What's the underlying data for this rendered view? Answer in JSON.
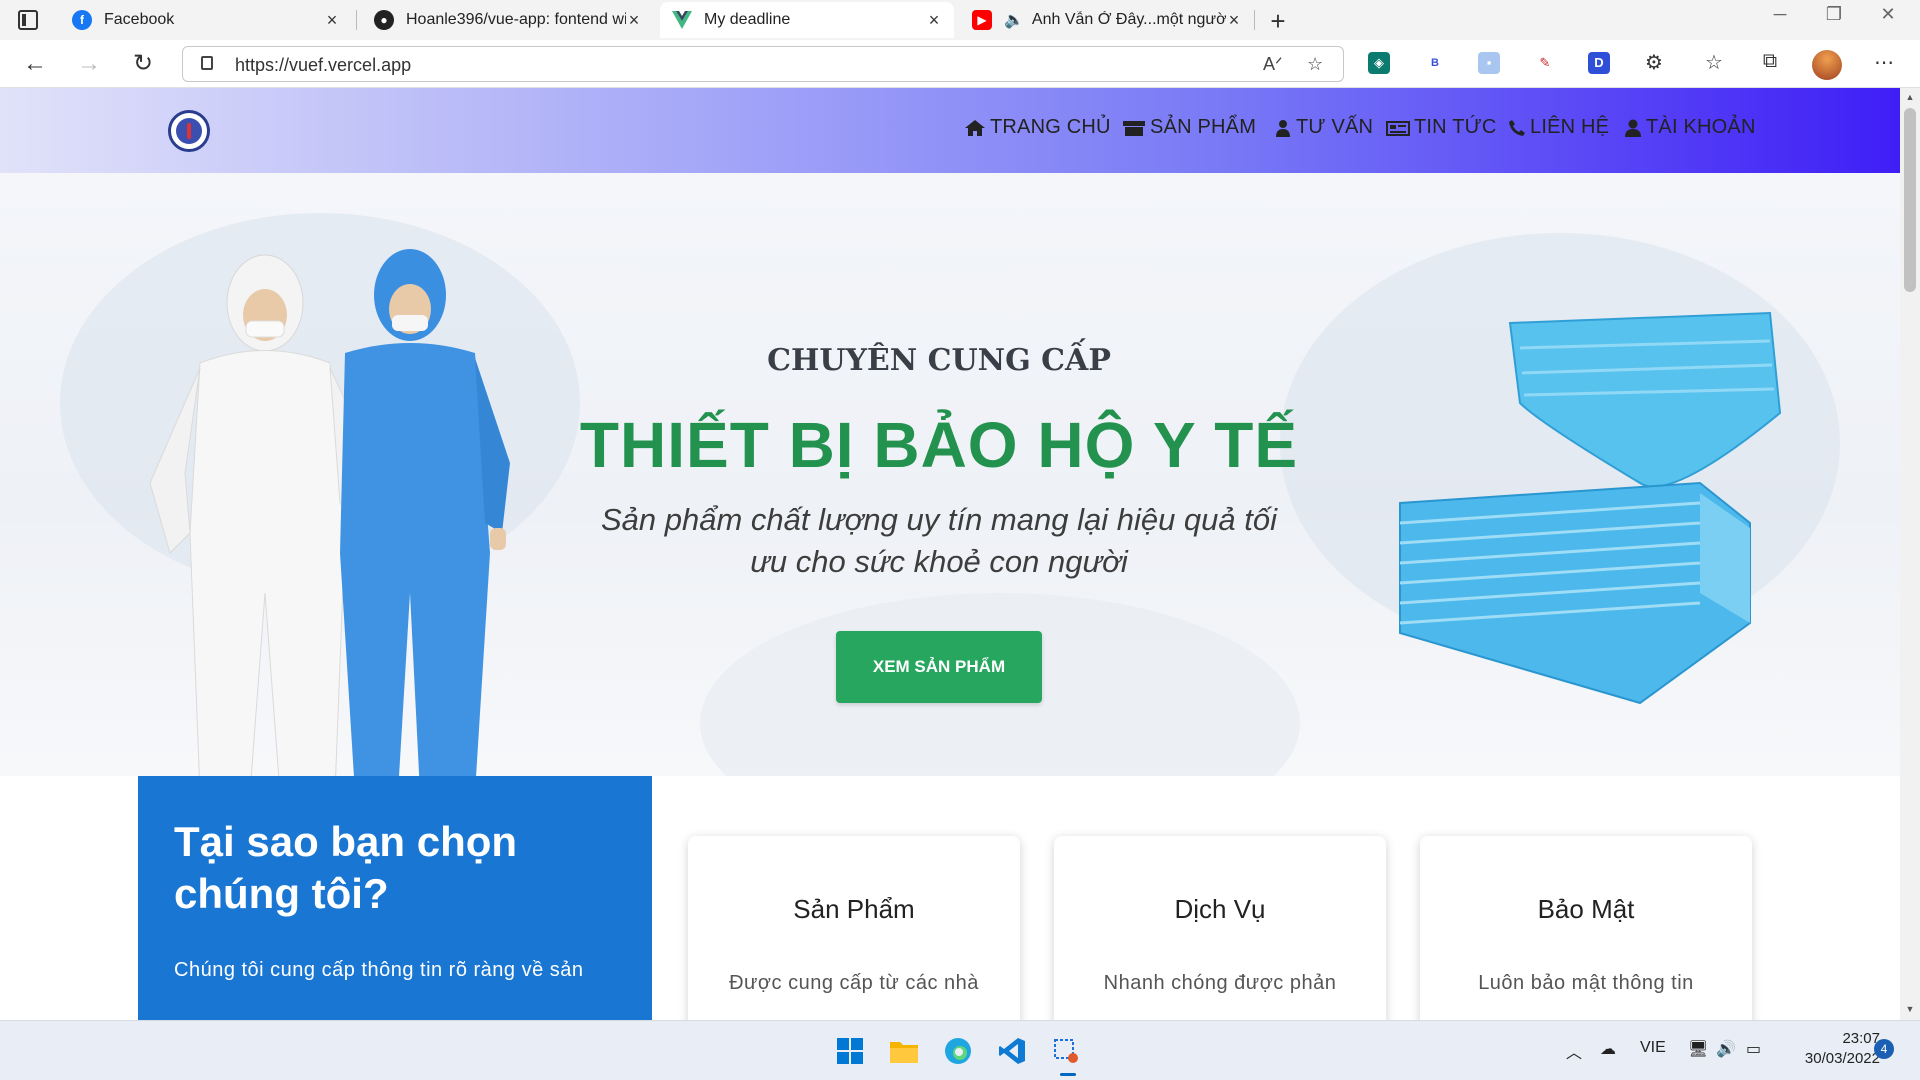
{
  "browser": {
    "tabs": [
      {
        "title": "Facebook",
        "icon": "facebook-icon"
      },
      {
        "title": "Hoanle396/vue-app: fontend wi",
        "icon": "github-icon"
      },
      {
        "title": "My deadline",
        "icon": "vue-icon"
      },
      {
        "title": "Anh Vẫn Ở Đây...một người",
        "icon": "youtube-icon"
      }
    ],
    "url": "https://vuef.vercel.app",
    "extensions": [
      "B",
      "D"
    ]
  },
  "site": {
    "nav": [
      {
        "label": "TRANG CHỦ",
        "icon": "home-icon"
      },
      {
        "label": "SẢN PHẨM",
        "icon": "store-icon"
      },
      {
        "label": "TƯ VẤN",
        "icon": "user-tie-icon"
      },
      {
        "label": "TIN TỨC",
        "icon": "newspaper-icon"
      },
      {
        "label": "LIÊN HỆ",
        "icon": "phone-icon"
      },
      {
        "label": "TÀI KHOẢN",
        "icon": "user-icon"
      }
    ],
    "hero": {
      "subtitle": "CHUYÊN CUNG CẤP",
      "title": "THIẾT BỊ BẢO HỘ Y TẾ",
      "description_line1": "Sản phẩm chất lượng uy tín mang lại hiệu quả tối",
      "description_line2": "ưu cho sức khoẻ con người",
      "button": "XEM SẢN PHẨM"
    },
    "why": {
      "title_line1": "Tại sao bạn chọn",
      "title_line2": "chúng tôi?",
      "text": "Chúng tôi cung cấp thông tin rõ ràng về sản"
    },
    "cards": [
      {
        "title": "Sản Phẩm",
        "text": "Được cung cấp từ các nhà"
      },
      {
        "title": "Dịch Vụ",
        "text": "Nhanh chóng được phản"
      },
      {
        "title": "Bảo Mật",
        "text": "Luôn bảo mật thông tin"
      }
    ],
    "colors": {
      "hero_title": "#23924f",
      "button": "#27a65f",
      "why_bg": "#1976d2",
      "header_end": "#3f1ef6"
    }
  },
  "taskbar": {
    "language": "VIE",
    "time": "23:07",
    "date": "30/03/2022",
    "notifications": "4"
  }
}
